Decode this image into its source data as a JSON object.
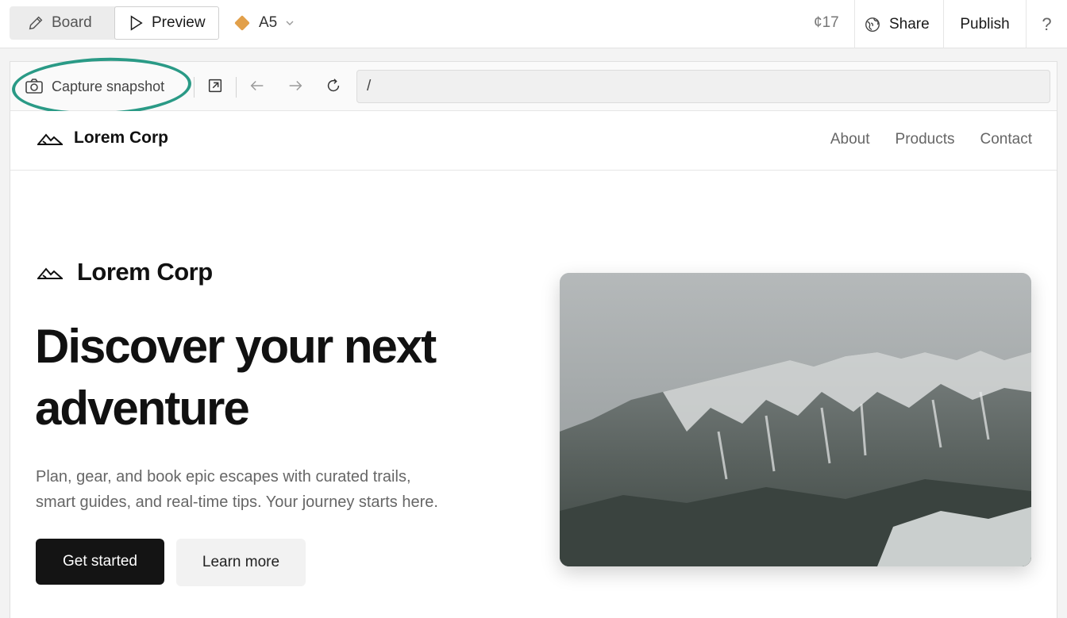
{
  "topbar": {
    "board_label": "Board",
    "preview_label": "Preview",
    "project_name": "A5",
    "credits": "¢17",
    "share_label": "Share",
    "publish_label": "Publish",
    "help_label": "?"
  },
  "preview_toolbar": {
    "snapshot_label": "Capture snapshot",
    "url_value": "/"
  },
  "site": {
    "brand_name": "Lorem Corp",
    "nav": [
      "About",
      "Products",
      "Contact"
    ],
    "hero_brand": "Lorem Corp",
    "headline_line1": "Discover your next",
    "headline_line2": "adventure",
    "subtext_line1": "Plan, gear, and book epic escapes with curated trails,",
    "subtext_line2": "smart guides, and real-time tips. Your journey starts here.",
    "primary_cta": "Get started",
    "secondary_cta": "Learn more"
  },
  "colors": {
    "accent_ring": "#2a9a86",
    "project_diamond": "#e2a04a",
    "primary_button": "#141414"
  }
}
